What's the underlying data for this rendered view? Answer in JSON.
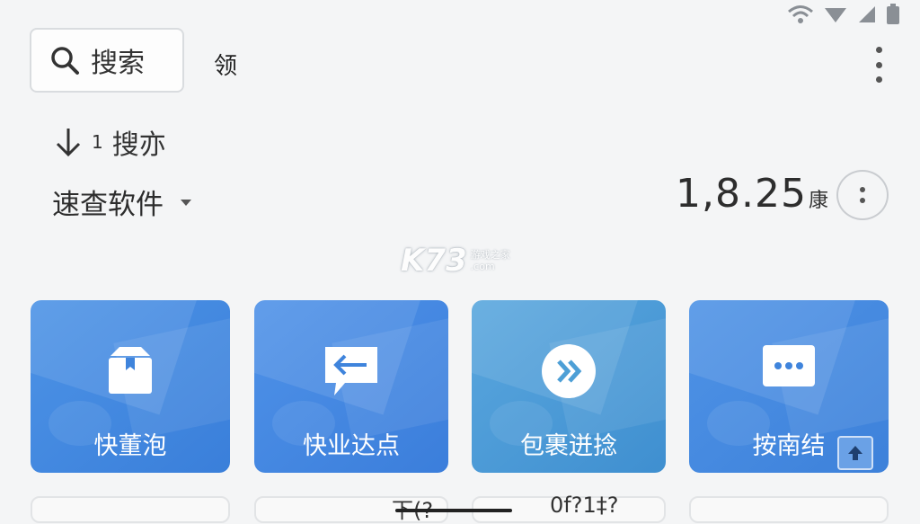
{
  "search": {
    "label": "搜索"
  },
  "top_text": "领",
  "sort": {
    "number": "1",
    "label": "搜亦"
  },
  "app_select": {
    "label": "速查软件"
  },
  "amount": {
    "value": "1,8.25",
    "unit": "康"
  },
  "watermark": {
    "brand": "K73",
    "line1": "游戏之家",
    "line2": ".com"
  },
  "tiles": [
    {
      "label": "快董泡",
      "icon": "package-icon"
    },
    {
      "label": "快业达点",
      "icon": "message-arrow-icon"
    },
    {
      "label": "包裹迸捻",
      "icon": "double-chevron-icon"
    },
    {
      "label": "按南结",
      "icon": "ellipsis-message-icon"
    }
  ],
  "bottom_texts": [
    "下(?",
    "0f?1‡?"
  ],
  "colors": {
    "tile_blue": "#3f84dc",
    "accent_teal": "#4d9fd6"
  }
}
